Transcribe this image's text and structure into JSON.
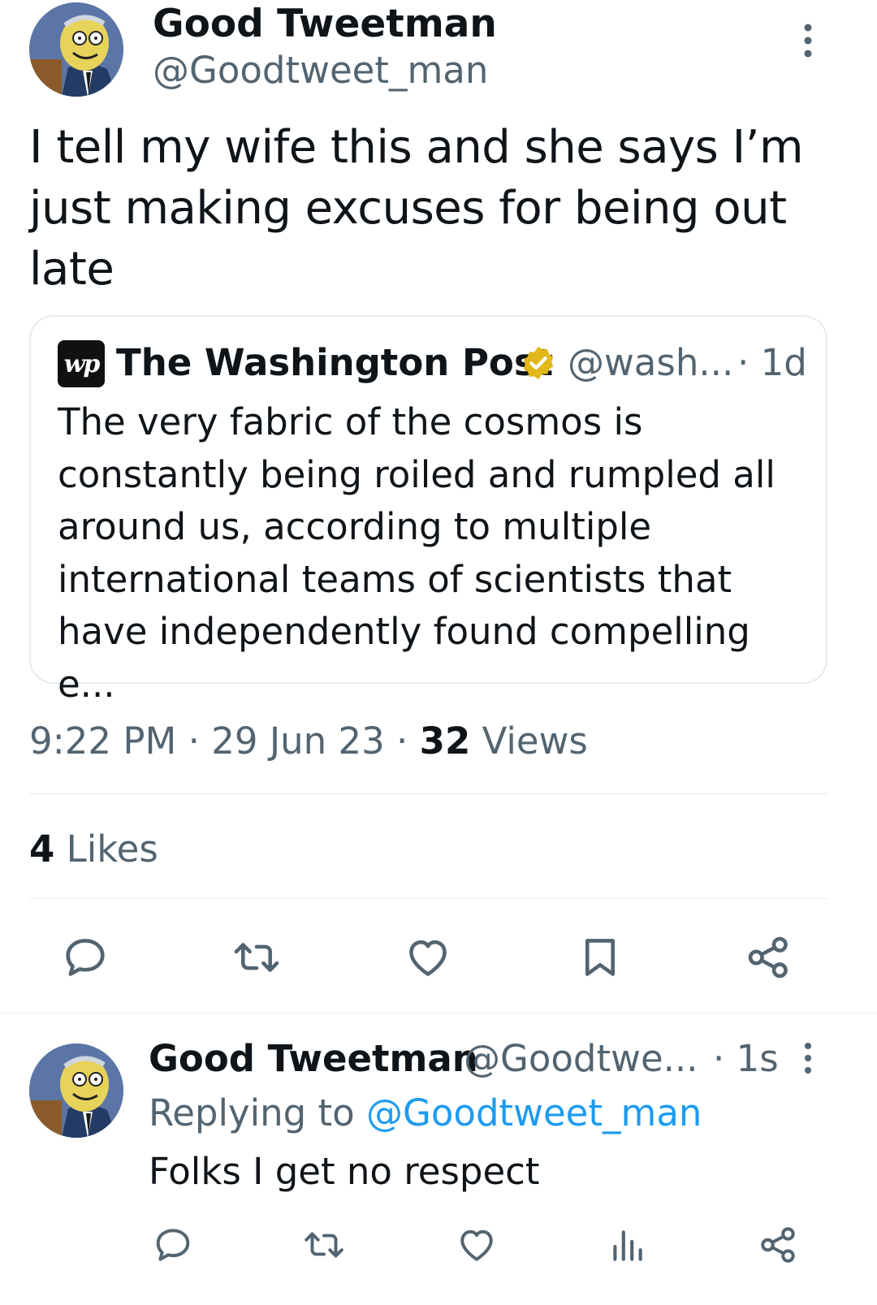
{
  "tweet": {
    "author_name": "Good Tweetman",
    "author_handle": "@Goodtweet_man",
    "text": "I tell my wife this and she says I’m just making excuses for being out late",
    "quote": {
      "logo_text": "wp",
      "name": "The Washington Post",
      "handle": "@wash...",
      "age": "· 1d",
      "text": "The very fabric of the cosmos is constantly being roiled and rumpled all around us, according to multiple international teams of scientists that have independently found compelling e..."
    },
    "time": "9:22 PM",
    "sep1": "·",
    "date": "29 Jun 23",
    "sep2": "·",
    "views_count": "32",
    "views_label": "Views",
    "likes_count": "4",
    "likes_label": "Likes"
  },
  "actions": [
    "reply-icon",
    "retweet-icon",
    "like-icon",
    "bookmark-icon",
    "share-icon"
  ],
  "reply": {
    "author_name": "Good Tweetman",
    "author_handle": "@Goodtwe...",
    "age": "· 1s",
    "replying_prefix": "Replying to",
    "replying_mention": "@Goodtweet_man",
    "text": "Folks I get no respect"
  },
  "reply_actions": [
    "reply-icon",
    "retweet-icon",
    "like-icon",
    "views-icon",
    "share-icon"
  ],
  "colors": {
    "text": "#0f1419",
    "secondary": "#536471",
    "link": "#1d9bf0",
    "verified": "#e2b719",
    "border": "#e6ecf0"
  }
}
